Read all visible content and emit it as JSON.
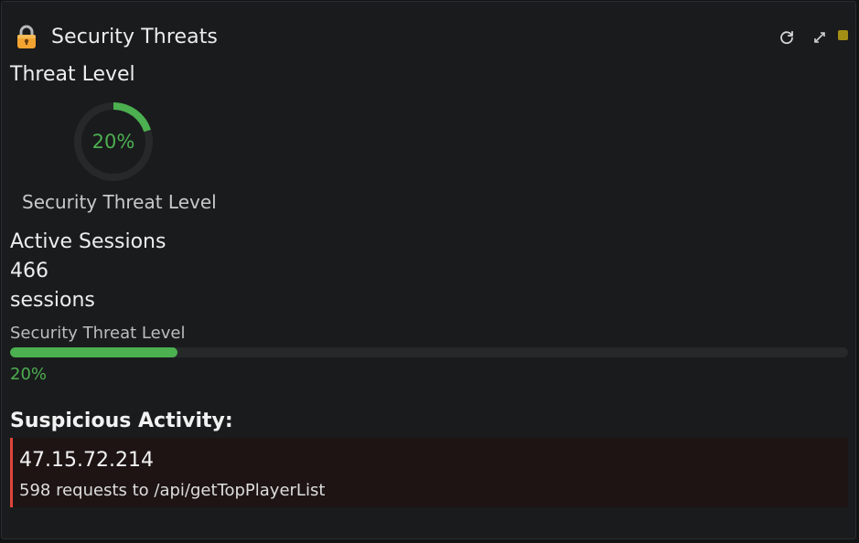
{
  "panel": {
    "title": "Security Threats",
    "lock_icon": "lock-icon",
    "actions": {
      "refresh_icon": "refresh-icon",
      "expand_icon": "expand-icon",
      "status_color": "#a38f14"
    }
  },
  "threat_level": {
    "heading": "Threat Level",
    "gauge_value_text": "20%",
    "gauge_fraction": 0.2,
    "caption": "Security Threat Level",
    "color": "#4caf50"
  },
  "active_sessions": {
    "heading": "Active Sessions",
    "count": "466",
    "unit": "sessions"
  },
  "threat_progress": {
    "label": "Security Threat Level",
    "fraction": 0.2,
    "value_text": "20%"
  },
  "suspicious": {
    "heading": "Suspicious Activity:",
    "items": [
      {
        "ip": "47.15.72.214",
        "detail": "598 requests to /api/getTopPlayerList",
        "accent_color": "#e0453a"
      }
    ]
  }
}
